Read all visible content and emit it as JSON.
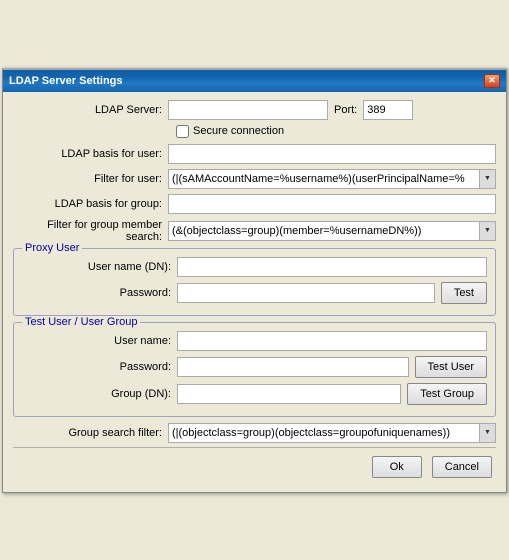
{
  "window": {
    "title": "LDAP Server Settings",
    "close_label": "✕"
  },
  "form": {
    "ldap_server_label": "LDAP Server:",
    "ldap_server_value": "",
    "port_label": "Port:",
    "port_value": "389",
    "secure_label": "Secure connection",
    "ldap_basis_user_label": "LDAP basis for user:",
    "ldap_basis_user_value": "",
    "filter_user_label": "Filter for user:",
    "filter_user_value": "(|(sAMAccountName=%username%)(userPrincipalName=%",
    "ldap_basis_group_label": "LDAP basis for group:",
    "ldap_basis_group_value": "",
    "filter_group_label": "Filter for group member search:",
    "filter_group_value": "(&(objectclass=group)(member=%usernameDN%))",
    "proxy_user_section_title": "Proxy User",
    "proxy_username_label": "User name (DN):",
    "proxy_username_value": "",
    "proxy_password_label": "Password:",
    "proxy_password_value": "",
    "proxy_test_btn": "Test",
    "test_section_title": "Test User / User Group",
    "test_username_label": "User name:",
    "test_username_value": "",
    "test_password_label": "Password:",
    "test_password_value": "",
    "test_user_btn": "Test User",
    "test_group_label": "Group (DN):",
    "test_group_value": "",
    "test_group_btn": "Test Group",
    "group_search_label": "Group search filter:",
    "group_search_value": "(|(objectclass=group)(objectclass=groupofuniquenames))",
    "ok_btn": "Ok",
    "cancel_btn": "Cancel"
  }
}
